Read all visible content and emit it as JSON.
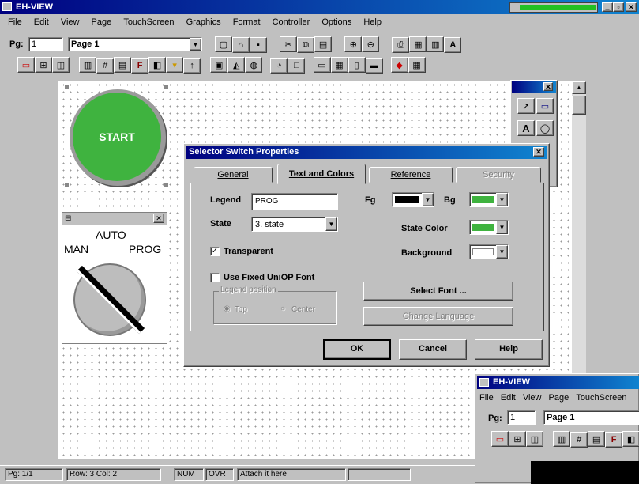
{
  "app": {
    "title": "EH-VIEW",
    "menu": [
      "File",
      "Edit",
      "View",
      "Page",
      "TouchScreen",
      "Graphics",
      "Format",
      "Controller",
      "Options",
      "Help"
    ],
    "page_label": "Pg:",
    "page_number": "1",
    "page_name": "Page 1"
  },
  "toolbar_icons": {
    "row1": [
      "new-icon",
      "open-icon",
      "save-icon",
      "cut-icon",
      "copy-icon",
      "paste-icon",
      "zoom-in-icon",
      "zoom-out-icon",
      "print-icon",
      "image-icon",
      "library-icon",
      "text-format-icon"
    ],
    "row2": [
      "indicator-icon",
      "switch-icon",
      "meter-icon",
      "bargraph-icon",
      "numeric-icon",
      "message-icon",
      "f-key-icon",
      "lamp-icon",
      "bell-icon",
      "arrow-icon",
      "picture-icon",
      "trend-icon",
      "gauge-icon",
      "dial-icon",
      "alarm-icon",
      "window-icon",
      "panel-icon",
      "data-icon",
      "ascii-icon",
      "export-icon",
      "color-icon"
    ]
  },
  "canvas": {
    "start_button_label": "START",
    "selector": {
      "top_label": "AUTO",
      "left_label": "MAN",
      "right_label": "PROG"
    }
  },
  "palette": {
    "tools": [
      "pointer-icon",
      "object-icon",
      "text-tool-icon",
      "shape-icon"
    ]
  },
  "dialog": {
    "title": "Selector Switch Properties",
    "tabs": [
      "General",
      "Text and Colors",
      "Reference",
      "Security"
    ],
    "active_tab": "Text and Colors",
    "legend_label": "Legend",
    "legend_value": "PROG",
    "state_label": "State",
    "state_value": "3. state",
    "fg_label": "Fg",
    "bg_label": "Bg",
    "state_color_label": "State Color",
    "background_label": "Background",
    "transparent_label": "Transparent",
    "transparent_checked": true,
    "fixed_font_label": "Use Fixed UniOP Font",
    "fixed_font_checked": false,
    "legend_position_label": "Legend position",
    "position_options": [
      "Top",
      "Center"
    ],
    "select_font_label": "Select Font ...",
    "change_language_label": "Change Language",
    "ok_label": "OK",
    "cancel_label": "Cancel",
    "help_label": "Help",
    "colors": {
      "fg": "#000000",
      "bg": "#3fb33f",
      "state_color": "#3fb33f",
      "background": "#ffffff"
    }
  },
  "statusbar": {
    "page": "Pg: 1/1",
    "row_col": "Row: 3  Col: 2",
    "num": "NUM",
    "ovr": "OVR",
    "attach": "Attach it here"
  },
  "overlay_window": {
    "title": "EH-VIEW",
    "menu": [
      "File",
      "Edit",
      "View",
      "Page",
      "TouchScreen"
    ],
    "page_label": "Pg:",
    "page_number": "1",
    "page_name": "Page 1"
  },
  "accent_colors": {
    "title_bar": "#000080",
    "green": "#3fb33f"
  }
}
